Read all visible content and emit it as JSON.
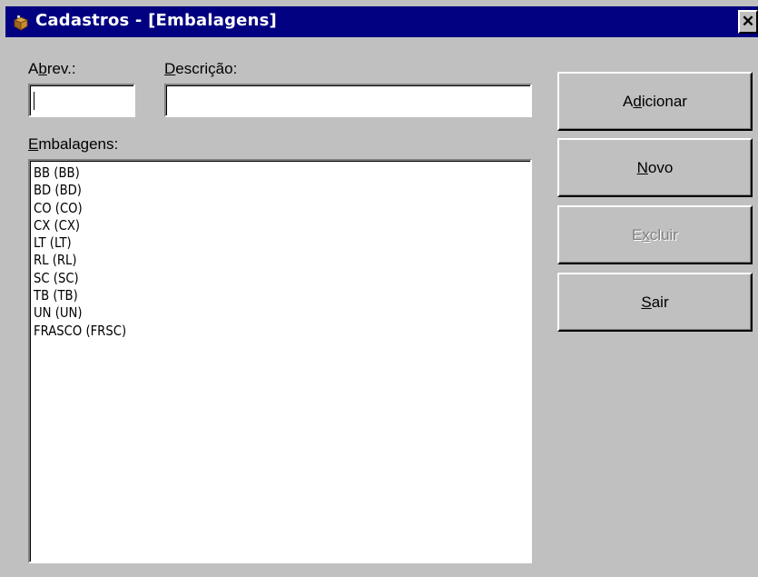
{
  "window": {
    "title": "Cadastros - [Embalagens]",
    "close_symbol": "✕",
    "icon": "package-icon"
  },
  "form": {
    "abrev": {
      "label_pre": "A",
      "label_u": "b",
      "label_post": "rev.:",
      "value": ""
    },
    "descricao": {
      "label_pre": "",
      "label_u": "D",
      "label_post": "escrição:",
      "value": ""
    },
    "list_label": {
      "pre": "",
      "u": "E",
      "post": "mbalagens:"
    }
  },
  "embalagens": [
    "BB (BB)",
    "BD (BD)",
    "CO (CO)",
    "CX (CX)",
    "LT (LT)",
    "RL (RL)",
    "SC (SC)",
    "TB (TB)",
    "UN (UN)",
    "FRASCO (FRSC)"
  ],
  "buttons": {
    "adicionar": {
      "pre": "A",
      "u": "d",
      "post": "icionar",
      "enabled": true
    },
    "novo": {
      "pre": "",
      "u": "N",
      "post": "ovo",
      "enabled": true
    },
    "excluir": {
      "pre": "E",
      "u": "x",
      "post": "cluir",
      "enabled": false
    },
    "sair": {
      "pre": "",
      "u": "S",
      "post": "air",
      "enabled": true
    }
  },
  "colors": {
    "titlebar": "#000080",
    "face": "#c0c0c0",
    "disabled_text": "#808080"
  }
}
